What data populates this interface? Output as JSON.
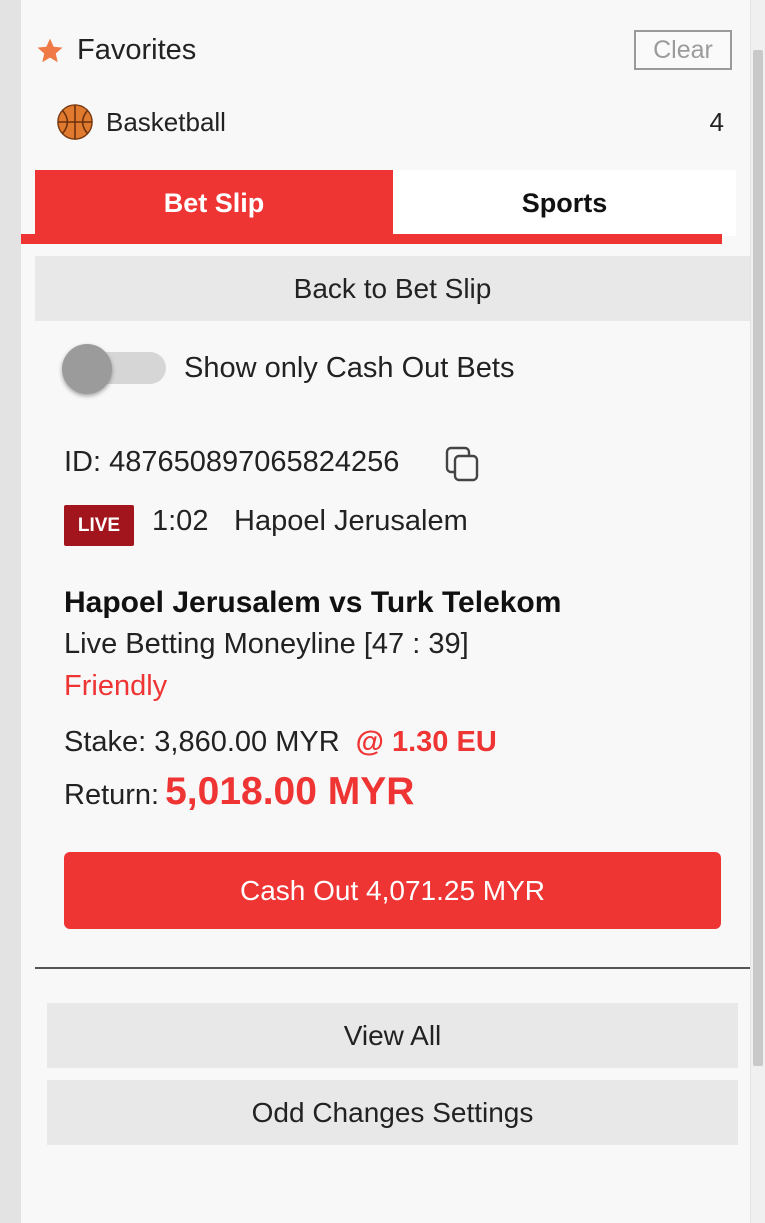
{
  "favorites": {
    "title": "Favorites",
    "clear_label": "Clear",
    "items": [
      {
        "label": "Basketball",
        "count": "4",
        "icon": "basketball-icon"
      }
    ]
  },
  "tabs": [
    {
      "label": "Bet Slip",
      "active": true
    },
    {
      "label": "Sports",
      "active": false
    }
  ],
  "back_label": "Back to Bet Slip",
  "toggle": {
    "label": "Show only Cash Out Bets",
    "on": false
  },
  "bet": {
    "id_text": "ID: 487650897065824256",
    "live_label": "LIVE",
    "time": "1:02",
    "team": "Hapoel Jerusalem",
    "match": "Hapoel Jerusalem vs Turk Telekom",
    "market": "Live Betting Moneyline [47 : 39]",
    "league": "Friendly",
    "stake_text": "Stake: 3,860.00 MYR",
    "odds_text": "@ 1.30 EU",
    "return_label": "Return:",
    "return_amount": "5,018.00 MYR",
    "cashout_label": "Cash Out 4,071.25 MYR"
  },
  "footer": {
    "view_all_label": "View All",
    "odd_changes_label": "Odd Changes Settings"
  },
  "colors": {
    "accent": "#ef3434",
    "live_badge": "#a3151c",
    "star": "#f07a45"
  }
}
